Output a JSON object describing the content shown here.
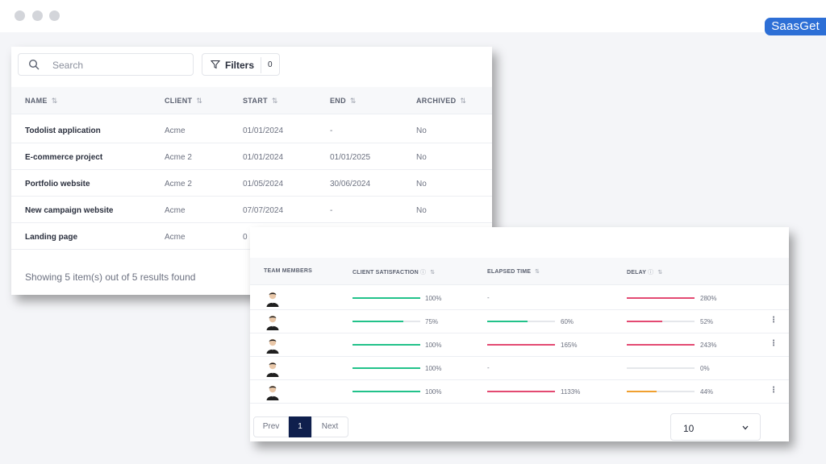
{
  "brand": "SaasGet",
  "toolbar": {
    "search_placeholder": "Search",
    "filters_label": "Filters",
    "filters_count": "0"
  },
  "projects": {
    "columns": [
      "NAME",
      "CLIENT",
      "START",
      "END",
      "ARCHIVED"
    ],
    "rows": [
      {
        "name": "Todolist application",
        "client": "Acme",
        "start": "01/01/2024",
        "end": "-",
        "archived": "No"
      },
      {
        "name": "E-commerce project",
        "client": "Acme 2",
        "start": "01/01/2024",
        "end": "01/01/2025",
        "archived": "No"
      },
      {
        "name": "Portfolio website",
        "client": "Acme 2",
        "start": "01/05/2024",
        "end": "30/06/2024",
        "archived": "No"
      },
      {
        "name": "New campaign website",
        "client": "Acme",
        "start": "07/07/2024",
        "end": "-",
        "archived": "No"
      },
      {
        "name": "Landing page",
        "client": "Acme",
        "start": "0",
        "end": "",
        "archived": ""
      }
    ],
    "showing": "Showing 5 item(s) out of 5 results found"
  },
  "metrics": {
    "columns": {
      "team": "TEAM MEMBERS",
      "satisfaction": "CLIENT SATISFACTION",
      "elapsed": "ELAPSED TIME",
      "delay": "DELAY"
    },
    "colors": {
      "green": "#22c28a",
      "red": "#e34a72",
      "orange": "#f0a030",
      "track": "#e5e7eb"
    },
    "rows": [
      {
        "satisfaction": {
          "pct": 1.0,
          "label": "100%"
        },
        "elapsed": null,
        "elapsed_label": "-",
        "delay": {
          "pct": 1.0,
          "label": "280%",
          "color": "red"
        },
        "menu": false
      },
      {
        "satisfaction": {
          "pct": 0.75,
          "label": "75%"
        },
        "elapsed": {
          "pct": 0.6,
          "label": "60%",
          "color": "green"
        },
        "delay": {
          "pct": 0.52,
          "label": "52%",
          "color": "red"
        },
        "menu": true
      },
      {
        "satisfaction": {
          "pct": 1.0,
          "label": "100%"
        },
        "elapsed": {
          "pct": 1.0,
          "label": "165%",
          "color": "red"
        },
        "delay": {
          "pct": 1.0,
          "label": "243%",
          "color": "red"
        },
        "menu": true
      },
      {
        "satisfaction": {
          "pct": 1.0,
          "label": "100%"
        },
        "elapsed": null,
        "elapsed_label": "-",
        "delay": {
          "pct": 0.0,
          "label": "0%",
          "color": "red"
        },
        "menu": false
      },
      {
        "satisfaction": {
          "pct": 1.0,
          "label": "100%"
        },
        "elapsed": {
          "pct": 1.0,
          "label": "1133%",
          "color": "red"
        },
        "delay": {
          "pct": 0.44,
          "label": "44%",
          "color": "orange"
        },
        "menu": true
      }
    ],
    "menu_glyph": "⋮"
  },
  "pagination": {
    "prev": "Prev",
    "current": "1",
    "next": "Next",
    "per_page": "10"
  }
}
